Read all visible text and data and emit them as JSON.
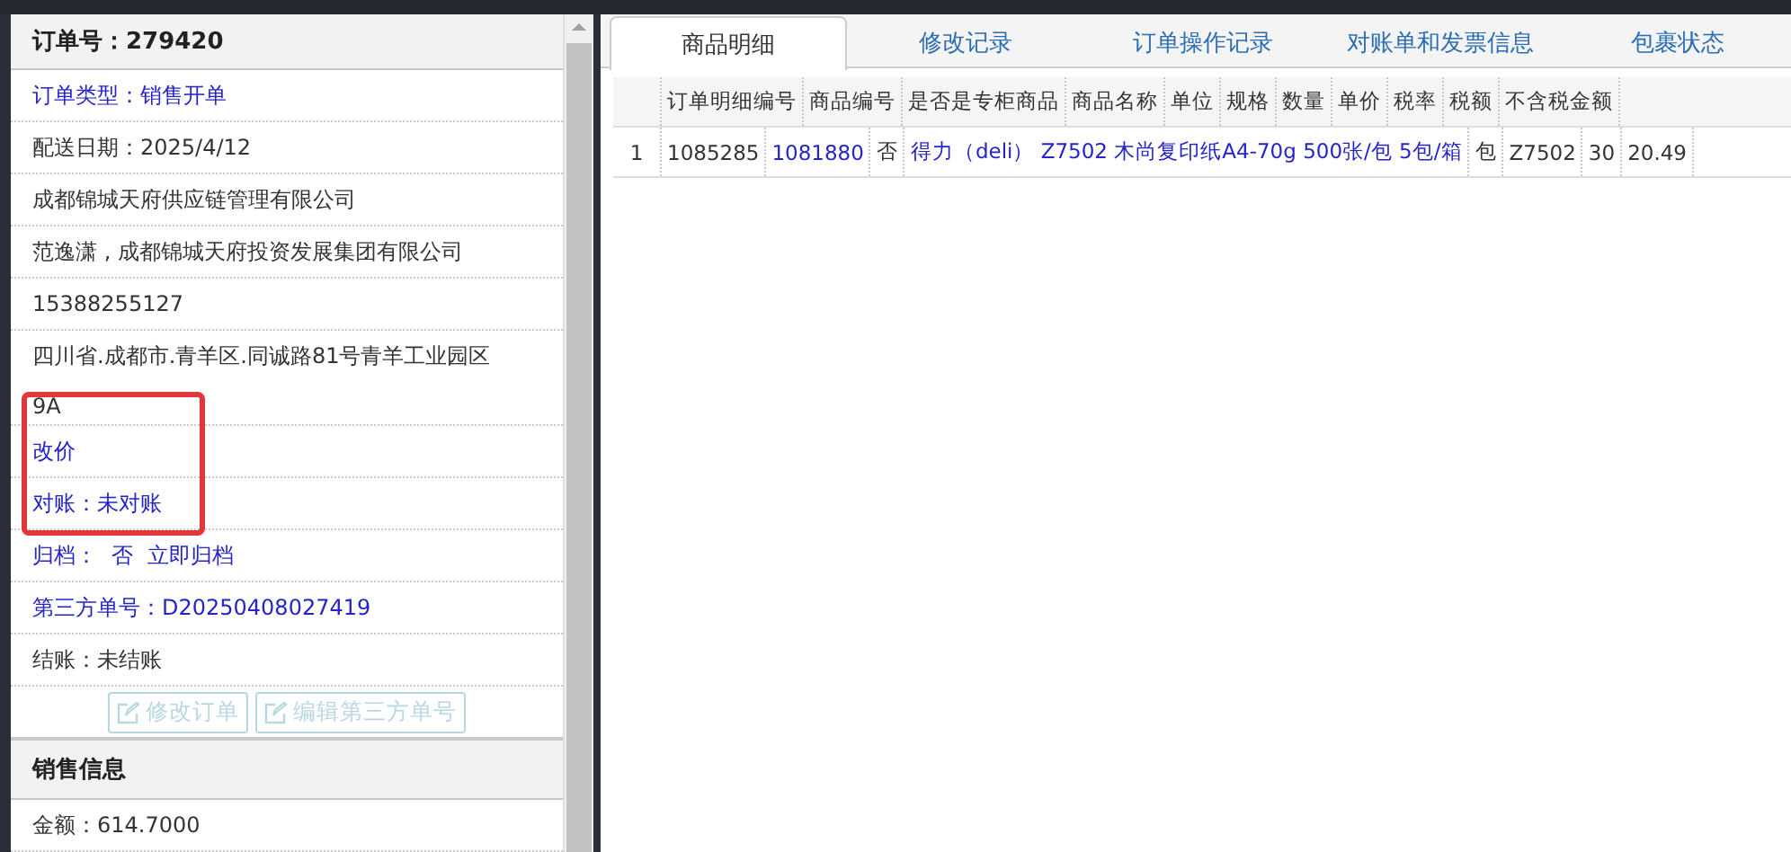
{
  "order_panel": {
    "title": "订单号：279420",
    "rows": [
      {
        "kind": "link",
        "text": "订单类型：销售开单"
      },
      {
        "kind": "text",
        "text": "配送日期：2025/4/12"
      },
      {
        "kind": "text",
        "text": "成都锦城天府供应链管理有限公司"
      },
      {
        "kind": "text",
        "text": "范逸潇 , 成都锦城天府投资发展集团有限公司"
      },
      {
        "kind": "text",
        "text": "15388255127"
      },
      {
        "kind": "text",
        "text": "四川省.成都市.青羊区.同诚路81号青羊工业园区9A"
      },
      {
        "kind": "link",
        "text": "改价"
      },
      {
        "kind": "link",
        "text": "对账：未对账"
      },
      {
        "kind": "archive",
        "label": "归档：",
        "value": "否",
        "action": "立即归档"
      },
      {
        "kind": "link",
        "text": "第三方单号：D20250408027419"
      },
      {
        "kind": "text",
        "text": "结账：未结账"
      }
    ],
    "buttons": [
      {
        "label": "修改订单",
        "disabled": true
      },
      {
        "label": "编辑第三方单号",
        "disabled": true
      }
    ],
    "section": {
      "title": "销售信息",
      "rows": [
        {
          "kind": "text",
          "text": "金额：614.7000"
        }
      ]
    }
  },
  "tabs": [
    {
      "label": "商品明细",
      "selected": true
    },
    {
      "label": "修改记录",
      "selected": false
    },
    {
      "label": "订单操作记录",
      "selected": false
    },
    {
      "label": "对账单和发票信息",
      "selected": false
    },
    {
      "label": "包裹状态",
      "selected": false
    }
  ],
  "detail_grid": {
    "header_row": [
      "订单明细编号",
      "商品编号",
      "是否是专柜商品",
      "商品名称",
      "单位",
      "规格",
      "数量",
      "单价",
      "税率",
      "税额",
      "不含税金额"
    ],
    "data_rows": [
      {
        "cells": [
          {
            "text": "1",
            "kind": "index"
          },
          {
            "text": "1085285",
            "kind": "text"
          },
          {
            "text": "1081880",
            "kind": "link"
          },
          {
            "text": "否",
            "kind": "text"
          },
          {
            "text": "得力（deli） Z7502 木尚复印纸A4-70g 500张/包 5包/箱",
            "kind": "link"
          },
          {
            "text": "包",
            "kind": "text"
          },
          {
            "text": "Z7502",
            "kind": "text"
          },
          {
            "text": "30",
            "kind": "text"
          },
          {
            "text": "20.49",
            "kind": "text"
          }
        ]
      }
    ]
  }
}
